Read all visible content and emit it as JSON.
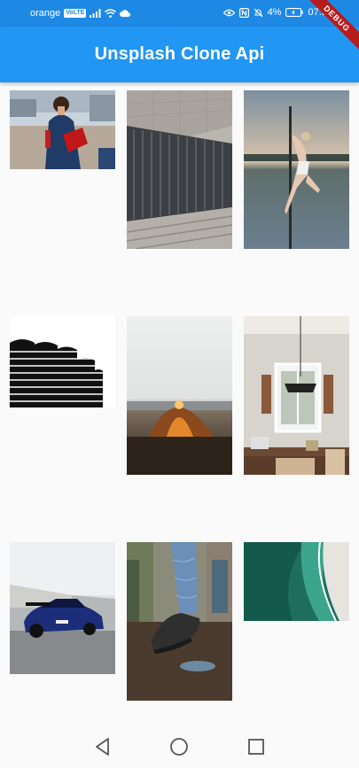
{
  "status": {
    "carrier": "orange",
    "volte": "VoLTE",
    "battery": "4%",
    "time": "07:50"
  },
  "app_bar": {
    "title": "Unsplash Clone Api"
  },
  "debug_banner": "DEBUG",
  "photos": [
    {
      "name": "woman-red-bag-photo"
    },
    {
      "name": "building-wall-photo"
    },
    {
      "name": "pole-dancer-photo"
    },
    {
      "name": "marina-towers-photo"
    },
    {
      "name": "tent-sunset-photo"
    },
    {
      "name": "dining-room-photo"
    },
    {
      "name": "blue-sports-car-photo"
    },
    {
      "name": "sneakers-jeans-photo"
    },
    {
      "name": "beach-aerial-photo"
    }
  ],
  "nav": {
    "icons": [
      "back-icon",
      "home-icon",
      "recents-icon"
    ]
  },
  "colors": {
    "app_bar": "#2196f3",
    "status_bar": "#1e88e5",
    "debug_banner": "#b71c1c",
    "background": "#fafafa"
  }
}
